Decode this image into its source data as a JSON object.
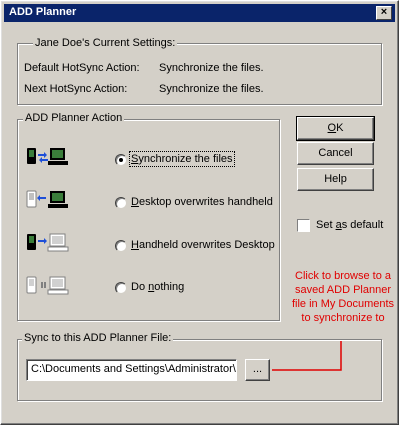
{
  "window": {
    "title": "ADD Planner",
    "close_glyph": "×"
  },
  "current_settings": {
    "group_label": "Jane Doe's  Current Settings:",
    "default_label": "Default HotSync Action:",
    "default_value": "Synchronize the files.",
    "next_label": "Next HotSync Action:",
    "next_value": "Synchronize the files."
  },
  "action_group": {
    "label": "ADD Planner Action",
    "options": [
      {
        "prefix": "",
        "ul": "S",
        "rest": "ynchronize the files",
        "selected": true,
        "icon": "sync-icon"
      },
      {
        "prefix": "",
        "ul": "D",
        "rest": "esktop overwrites handheld",
        "selected": false,
        "icon": "desktop-to-handheld-icon"
      },
      {
        "prefix": "",
        "ul": "H",
        "rest": "andheld overwrites Desktop",
        "selected": false,
        "icon": "handheld-to-desktop-icon"
      },
      {
        "prefix": "Do ",
        "ul": "n",
        "rest": "othing",
        "selected": false,
        "icon": "do-nothing-icon"
      }
    ]
  },
  "buttons": {
    "ok": {
      "ul": "O",
      "rest": "K"
    },
    "cancel": "Cancel",
    "help": "Help"
  },
  "set_default": {
    "prefix": "Set ",
    "ul": "a",
    "rest": "s default",
    "checked": false
  },
  "sync_file": {
    "group_label": "Sync to this ADD Planner File:",
    "path": "C:\\Documents and Settings\\Administrator\\",
    "browse_label": "..."
  },
  "annotation": {
    "text": "Click to browse to a saved ADD Planner file in My Documents to synchronize to",
    "color": "#e00000"
  }
}
